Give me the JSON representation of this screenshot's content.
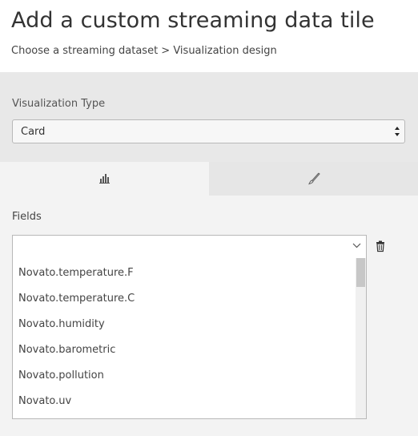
{
  "header": {
    "title": "Add a custom streaming data tile",
    "breadcrumb": "Choose a streaming dataset > Visualization design"
  },
  "visualization": {
    "label": "Visualization Type",
    "selected": "Card"
  },
  "tabs": [
    {
      "icon": "bar-chart-icon"
    },
    {
      "icon": "paintbrush-icon"
    }
  ],
  "fields": {
    "label": "Fields",
    "value": "",
    "options": [
      "Novato.temperature.F",
      "Novato.temperature.C",
      "Novato.humidity",
      "Novato.barometric",
      "Novato.pollution",
      "Novato.uv"
    ]
  },
  "colors": {
    "gray_band": "#e8e8e8",
    "panel": "#f3f3f3",
    "text": "#333333"
  }
}
